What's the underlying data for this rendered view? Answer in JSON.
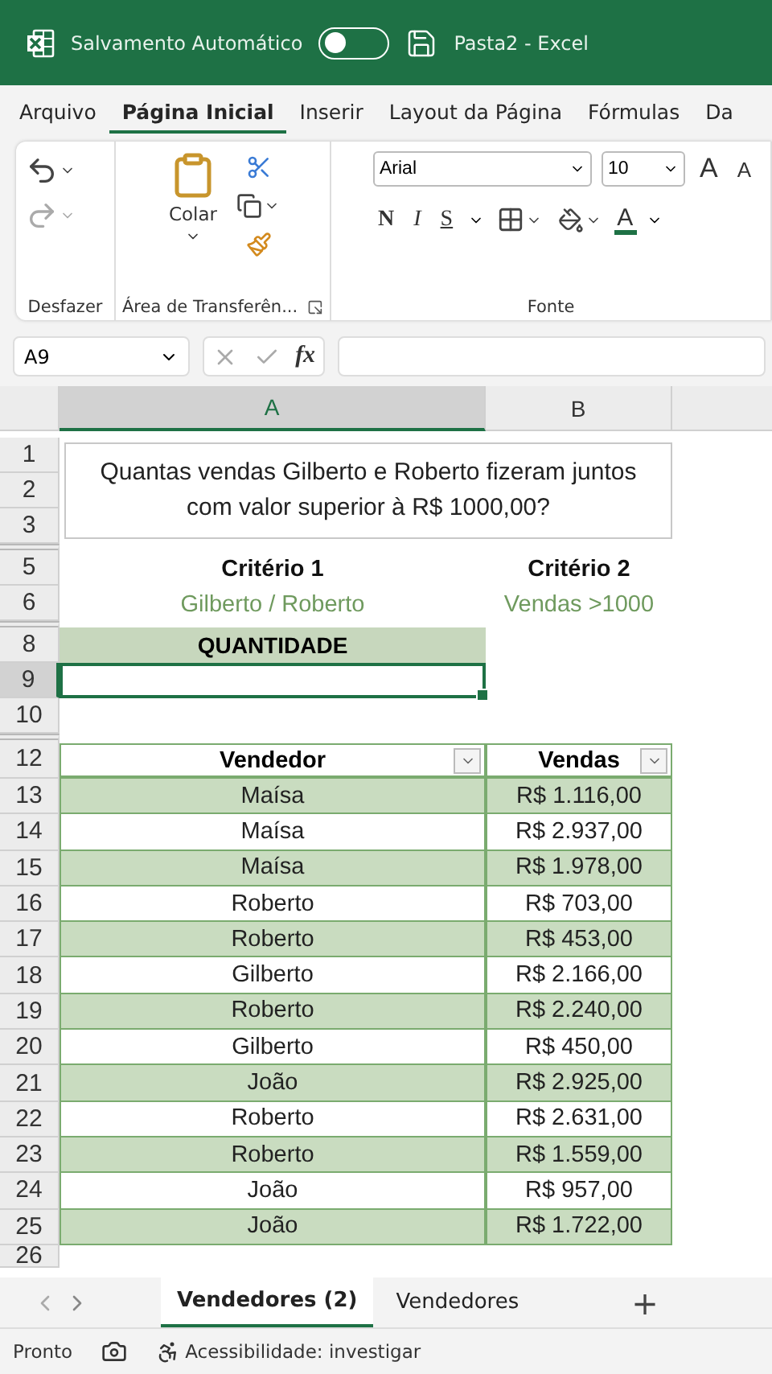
{
  "title_bar": {
    "autosave_label": "Salvamento Automático",
    "autosave_on": false,
    "file_name": "Pasta2  -  Excel"
  },
  "menu_tabs": [
    {
      "label": "Arquivo",
      "selected": false
    },
    {
      "label": "Página Inicial",
      "selected": true
    },
    {
      "label": "Inserir",
      "selected": false
    },
    {
      "label": "Layout da Página",
      "selected": false
    },
    {
      "label": "Fórmulas",
      "selected": false
    },
    {
      "label": "Da",
      "selected": false
    }
  ],
  "ribbon": {
    "groups": [
      "Desfazer",
      "Área de Transferên...",
      "Fonte"
    ],
    "paste_label": "Colar",
    "font_name": "Arial",
    "font_size": "10",
    "grow_letter": "A",
    "shrink_letter": "A",
    "bold_letter": "N",
    "italic_letter": "I",
    "underline_letter": "S",
    "font_color_letter": "A"
  },
  "formula_bar": {
    "name_box": "A9",
    "fx": "fx"
  },
  "column_headers": [
    {
      "label": "A",
      "selected": true
    },
    {
      "label": "B",
      "selected": false
    }
  ],
  "row_headers": [
    {
      "label": "1",
      "selected": false,
      "gap_before": false
    },
    {
      "label": "2",
      "selected": false,
      "gap_before": false
    },
    {
      "label": "3",
      "selected": false,
      "gap_before": false
    },
    {
      "label": "5",
      "selected": false,
      "gap_before": true
    },
    {
      "label": "6",
      "selected": false,
      "gap_before": false
    },
    {
      "label": "8",
      "selected": false,
      "gap_before": true
    },
    {
      "label": "9",
      "selected": true,
      "gap_before": false
    },
    {
      "label": "10",
      "selected": false,
      "gap_before": false
    },
    {
      "label": "12",
      "selected": false,
      "gap_before": true
    },
    {
      "label": "13",
      "selected": false,
      "gap_before": false
    },
    {
      "label": "14",
      "selected": false,
      "gap_before": false
    },
    {
      "label": "15",
      "selected": false,
      "gap_before": false
    },
    {
      "label": "16",
      "selected": false,
      "gap_before": false
    },
    {
      "label": "17",
      "selected": false,
      "gap_before": false
    },
    {
      "label": "18",
      "selected": false,
      "gap_before": false
    },
    {
      "label": "19",
      "selected": false,
      "gap_before": false
    },
    {
      "label": "20",
      "selected": false,
      "gap_before": false
    },
    {
      "label": "21",
      "selected": false,
      "gap_before": false
    },
    {
      "label": "22",
      "selected": false,
      "gap_before": false
    },
    {
      "label": "23",
      "selected": false,
      "gap_before": false
    },
    {
      "label": "24",
      "selected": false,
      "gap_before": false
    },
    {
      "label": "25",
      "selected": false,
      "gap_before": false
    },
    {
      "label": "26",
      "selected": false,
      "gap_before": false
    }
  ],
  "question": "Quantas vendas Gilberto e Roberto fizeram juntos com valor superior à R$ 1000,00?",
  "criteria": [
    {
      "title": "Critério 1",
      "value": "Gilberto / Roberto"
    },
    {
      "title": "Critério 2",
      "value": "Vendas >1000"
    }
  ],
  "quantity_label": "QUANTIDADE",
  "table": {
    "columns": [
      "Vendedor",
      "Vendas"
    ],
    "rows": [
      {
        "vendedor": "Maísa",
        "vendas": "R$ 1.116,00"
      },
      {
        "vendedor": "Maísa",
        "vendas": "R$ 2.937,00"
      },
      {
        "vendedor": "Maísa",
        "vendas": "R$ 1.978,00"
      },
      {
        "vendedor": "Roberto",
        "vendas": "R$ 703,00"
      },
      {
        "vendedor": "Roberto",
        "vendas": "R$ 453,00"
      },
      {
        "vendedor": "Gilberto",
        "vendas": "R$ 2.166,00"
      },
      {
        "vendedor": "Roberto",
        "vendas": "R$ 2.240,00"
      },
      {
        "vendedor": "Gilberto",
        "vendas": "R$ 450,00"
      },
      {
        "vendedor": "João",
        "vendas": "R$ 2.925,00"
      },
      {
        "vendedor": "Roberto",
        "vendas": "R$ 2.631,00"
      },
      {
        "vendedor": "Roberto",
        "vendas": "R$ 1.559,00"
      },
      {
        "vendedor": "João",
        "vendas": "R$ 957,00"
      },
      {
        "vendedor": "João",
        "vendas": "R$ 1.722,00"
      }
    ]
  },
  "sheet_tabs": [
    {
      "label": "Vendedores (2)",
      "selected": true
    },
    {
      "label": "Vendedores",
      "selected": false
    }
  ],
  "add_sheet": "+",
  "status_bar": {
    "status": "Pronto",
    "accessibility": "Acessibilidade: investigar"
  }
}
